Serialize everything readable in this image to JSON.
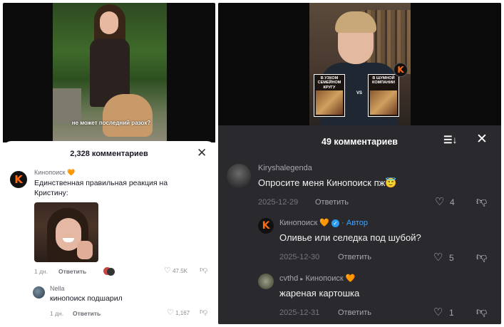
{
  "left": {
    "video_caption": "не может последний разок?",
    "sheet_title": "2,328 комментариев",
    "close_icon": "close-icon",
    "comments": [
      {
        "author": "Кинопоиск",
        "author_emoji": "🧡",
        "text": "Единственная правильная реакция на Кристину:",
        "time": "1 дн.",
        "reply_label": "Ответить",
        "likes": "47.5K"
      },
      {
        "author": "Nella",
        "text": "кинопоиск подшарил",
        "time": "1 дн.",
        "reply_label": "Ответить",
        "likes": "1,167"
      }
    ]
  },
  "right": {
    "video_cards": [
      "В УЗКОМ СЕМЕЙНОМ КРУГУ",
      "В ШУМНОЙ КОМПАНИИ"
    ],
    "video_vs": "VS",
    "sheet_title": "49 комментариев",
    "comments": [
      {
        "author": "Kiryshalegenda",
        "text": "Опросите меня Кинопоиск пж😇",
        "date": "2025-12-29",
        "reply_label": "Ответить",
        "likes": "4"
      },
      {
        "author": "Кинопоиск",
        "author_emoji": "🧡",
        "author_tag": "· Автор",
        "text": "Оливье или селедка под шубой?",
        "date": "2025-12-30",
        "reply_label": "Ответить",
        "likes": "5"
      },
      {
        "author": "cvthd",
        "reply_to": "Кинопоиск",
        "reply_to_emoji": "🧡",
        "text": "жареная картошка",
        "date": "2025-12-31",
        "reply_label": "Ответить",
        "likes": "1"
      }
    ]
  },
  "colors": {
    "kinopoisk_orange": "#ff6a10",
    "dark_sheet": "#2a2a2e",
    "author_blue": "#3ea3ff"
  }
}
